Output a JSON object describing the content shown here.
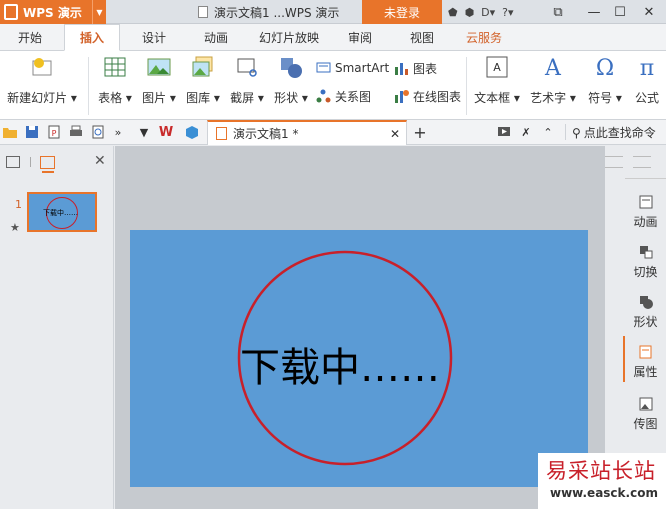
{
  "app": {
    "name": "WPS 演示",
    "doc_title": "演示文稿1 ...WPS 演示",
    "login": "未登录"
  },
  "tabs": [
    {
      "label": "开始"
    },
    {
      "label": "插入"
    },
    {
      "label": "设计"
    },
    {
      "label": "动画"
    },
    {
      "label": "幻灯片放映"
    },
    {
      "label": "审阅"
    },
    {
      "label": "视图"
    },
    {
      "label": "云服务"
    }
  ],
  "ribbon": {
    "new_slide": "新建幻灯片",
    "table": "表格",
    "picture": "图片",
    "gallery": "图库",
    "screenshot": "截屏",
    "shapes": "形状",
    "smartart": "SmartArt",
    "chart": "图表",
    "relation": "关系图",
    "online_chart": "在线图表",
    "textbox": "文本框",
    "wordart": "艺术字",
    "symbol": "符号",
    "formula": "公式"
  },
  "doc_tab": {
    "label": "演示文稿1 *"
  },
  "search": {
    "label": "点此查找命令"
  },
  "slides": [
    {
      "number": "1",
      "thumb_text": "下载中……"
    }
  ],
  "slide": {
    "text": "下载中……",
    "bg_color": "#5b9bd5",
    "circle_color": "#c8202a"
  },
  "right_panel": {
    "items": [
      {
        "label": "动画"
      },
      {
        "label": "切换"
      },
      {
        "label": "形状"
      },
      {
        "label": "属性"
      },
      {
        "label": "传图"
      }
    ]
  },
  "watermark": {
    "title": "易采站长站",
    "url": "www.easck.com"
  },
  "colors": {
    "accent": "#e8742a",
    "slide_bg": "#5b9bd5",
    "circle": "#c8202a"
  }
}
